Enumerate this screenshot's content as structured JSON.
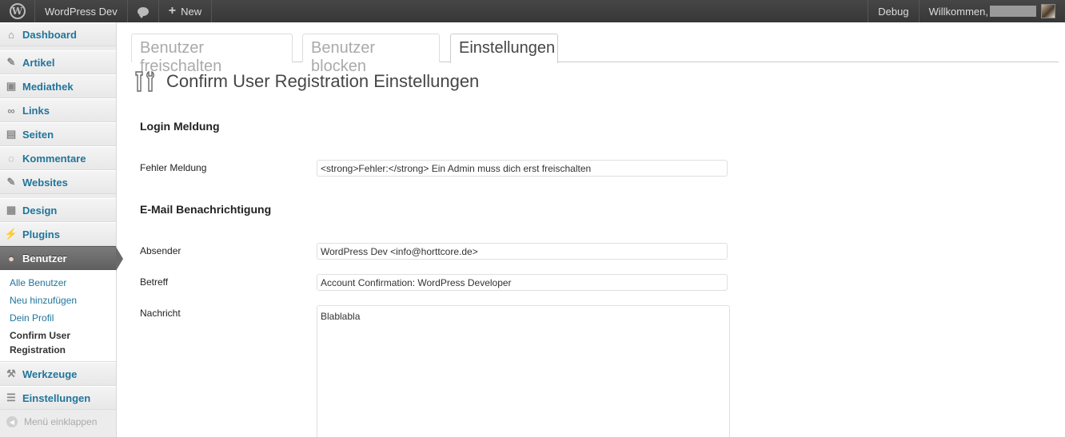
{
  "adminbar": {
    "site_name": "WordPress Dev",
    "new_label": "New",
    "debug_label": "Debug",
    "welcome": "Willkommen,"
  },
  "sidebar": {
    "items": [
      {
        "label": "Dashboard",
        "icon": "dashboard-icon"
      },
      {
        "label": "Artikel",
        "icon": "pin-icon"
      },
      {
        "label": "Mediathek",
        "icon": "media-icon"
      },
      {
        "label": "Links",
        "icon": "link-icon"
      },
      {
        "label": "Seiten",
        "icon": "page-icon"
      },
      {
        "label": "Kommentare",
        "icon": "comment-icon"
      },
      {
        "label": "Websites",
        "icon": "pin-icon"
      },
      {
        "label": "Design",
        "icon": "design-icon"
      },
      {
        "label": "Plugins",
        "icon": "plugin-icon"
      },
      {
        "label": "Benutzer",
        "icon": "users-icon"
      },
      {
        "label": "Werkzeuge",
        "icon": "tools-icon"
      },
      {
        "label": "Einstellungen",
        "icon": "settings-icon"
      }
    ],
    "submenu": [
      "Alle Benutzer",
      "Neu hinzufügen",
      "Dein Profil",
      "Confirm User Registration"
    ],
    "collapse_label": "Menü einklappen"
  },
  "tabs": [
    "Benutzer freischalten",
    "Benutzer blocken",
    "Einstellungen"
  ],
  "page_title": "Confirm User Registration Einstellungen",
  "sections": {
    "login": "Login Meldung",
    "email": "E-Mail Benachrichtigung"
  },
  "fields": {
    "error_label": "Fehler Meldung",
    "error_value": "<strong>Fehler:</strong> Ein Admin muss dich erst freischalten",
    "sender_label": "Absender",
    "sender_value": "WordPress Dev <info@horttcore.de>",
    "subject_label": "Betreff",
    "subject_value": "Account Confirmation: WordPress Developer",
    "message_label": "Nachricht",
    "message_value": "Blablabla"
  },
  "colors": {
    "link": "#21759b",
    "adminbar": "#464646",
    "current_menu": "#6a6a6a"
  }
}
